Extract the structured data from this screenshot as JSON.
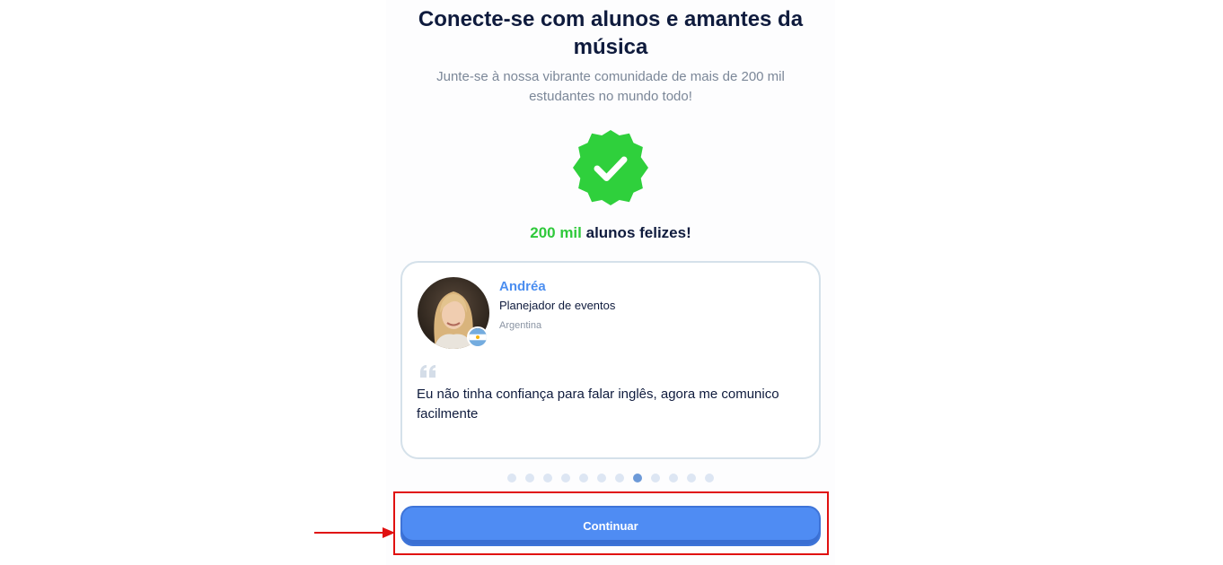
{
  "onboarding": {
    "title": "Conecte-se com alunos e amantes da música",
    "subtitle": "Junte-se à nossa vibrante comunidade de mais de 200 mil estudantes no mundo todo!",
    "happy_highlight": "200 mil",
    "happy_rest": " alunos felizes!"
  },
  "testimonial": {
    "name": "Andréa",
    "role": "Planejador de eventos",
    "country": "Argentina",
    "quote": "Eu não tinha confiança para falar inglês, agora me comunico facilmente"
  },
  "carousel": {
    "total": 12,
    "active_index": 7
  },
  "actions": {
    "continue_label": "Continuar"
  },
  "colors": {
    "accent": "#4f8cf3",
    "success": "#2fc93b",
    "annotation": "#e01010"
  }
}
